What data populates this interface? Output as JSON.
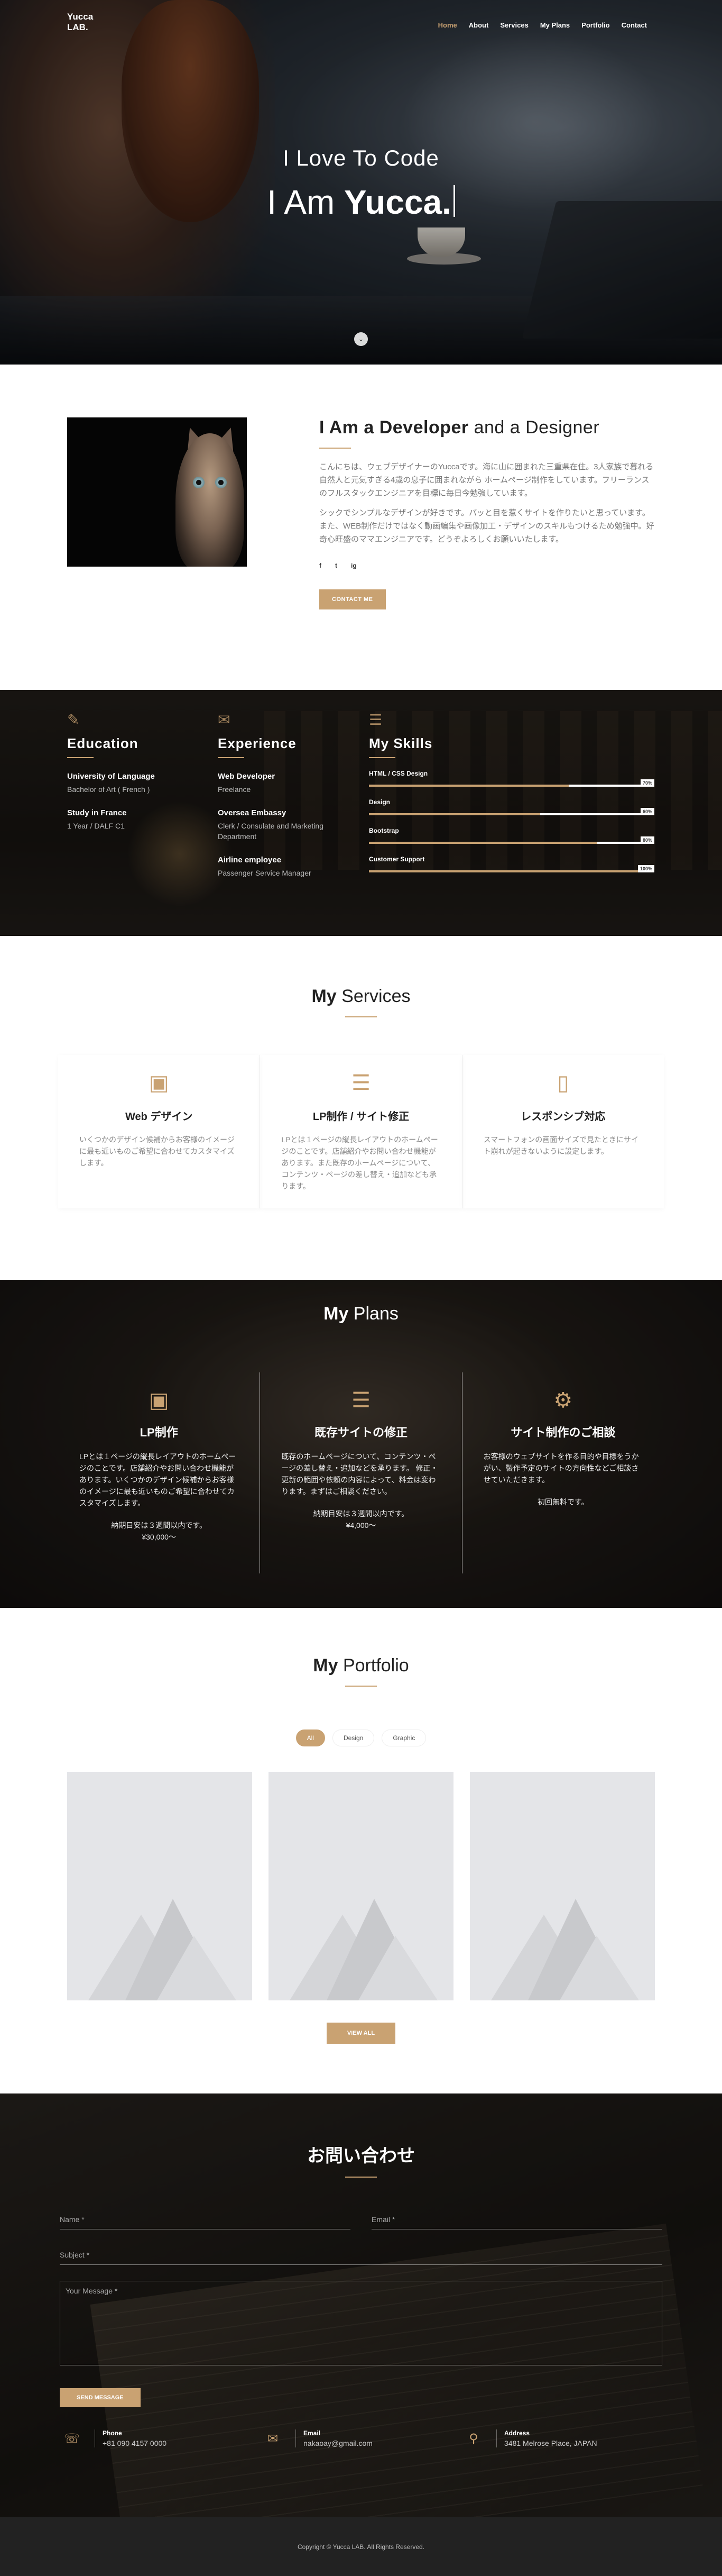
{
  "nav": {
    "logo_line1": "Yucca",
    "logo_line2": "LAB.",
    "items": [
      "Home",
      "About",
      "Services",
      "My Plans",
      "Portfolio",
      "Contact"
    ]
  },
  "hero": {
    "subtitle": "I Love To Code",
    "title_prefix": "I Am ",
    "title_bold": "Yucca.",
    "scroll_icon": "chevron-down-icon"
  },
  "about": {
    "title_bold": "I Am a Developer",
    "title_rest": " and a Designer",
    "p1": "こんにちは、ウェブデザイナーのYuccaです。海に山に囲まれた三重県在住。3人家族で暮れる自然人と元気すぎる4歳の息子に囲まれながら ホームページ制作をしています。フリーランスのフルスタックエンジニアを目標に毎日今勉強しています。",
    "p2": "シックでシンプルなデザインが好きです。パッと目を惹くサイトを作りたいと思っています。また、WEB制作だけではなく動画編集や画像加工・デザインのスキルもつけるため勉強中。好奇心旺盛のママエンジニアです。どうぞよろしくお願いいたします。",
    "socials": [
      "f",
      "t",
      "ig"
    ],
    "button": "CONTACT ME"
  },
  "resume": {
    "education": {
      "title": "Education",
      "items": [
        {
          "h": "University of Language",
          "d": "Bachelor of Art ( French )"
        },
        {
          "h": "Study in France",
          "d": "1 Year / DALF C1"
        }
      ]
    },
    "experience": {
      "title": "Experience",
      "items": [
        {
          "h": "Web Developer",
          "d": "Freelance"
        },
        {
          "h": "Oversea Embassy",
          "d": "Clerk / Consulate and Marketing Department"
        },
        {
          "h": "Airline employee",
          "d": "Passenger Service Manager"
        }
      ]
    },
    "skills": {
      "title": "My Skills",
      "items": [
        {
          "label": "HTML / CSS Design",
          "pct_text": "70%",
          "value": 0.7
        },
        {
          "label": "Design",
          "pct_text": "60%",
          "value": 0.6
        },
        {
          "label": "Bootstrap",
          "pct_text": "80%",
          "value": 0.8
        },
        {
          "label": "Customer Support",
          "pct_text": "100%",
          "value": 1.0
        }
      ]
    }
  },
  "services": {
    "title_bold": "My",
    "title_rest": " Services",
    "items": [
      {
        "icon": "laptop-icon",
        "title": "Web デザイン",
        "desc": "いくつかのデザイン候補からお客様のイメージに最も近いものご希望に合わせてカスタマイズします。"
      },
      {
        "icon": "layers-icon",
        "title": "LP制作 / サイト修正",
        "desc": "LPとは１ページの縦長レイアウトのホームページのことです。店舗紹介やお問い合わせ機能があります。また既存のホームページについて、コンテンツ・ページの差し替え・追加なども承ります。"
      },
      {
        "icon": "mobile-icon",
        "title": "レスポンシブ対応",
        "desc": "スマートフォンの画面サイズで見たときにサイト崩れが起きないように設定します。"
      }
    ]
  },
  "plans": {
    "title_bold": "My",
    "title_rest": " Plans",
    "items": [
      {
        "icon": "laptop-icon",
        "title": "LP制作",
        "desc": "LPとは１ページの縦長レイアウトのホームページのことです。店舗紹介やお問い合わせ機能があります。いくつかのデザイン候補からお客様のイメージに最も近いものご希望に合わせてカスタマイズします。",
        "price1": "納期目安は３週間以内です。",
        "price2": "¥30,000〜"
      },
      {
        "icon": "layers-icon",
        "title": "既存サイトの修正",
        "desc": "既存のホームページについて、コンテンツ・ページの差し替え・追加などを承ります。 修正・更新の範囲や依頼の内容によって、料金は変わります。まずはご相談ください。",
        "price1": "納期目安は３週間以内です。",
        "price2": "¥4,000〜"
      },
      {
        "icon": "gears-icon",
        "title": "サイト制作のご相談",
        "desc": "お客様のウェブサイトを作る目的や目標をうかがい、製作予定のサイトの方向性などご相談させていただきます。",
        "price1": "初回無料です。",
        "price2": ""
      }
    ]
  },
  "portfolio": {
    "title_bold": "My",
    "title_rest": " Portfolio",
    "filters": [
      "All",
      "Design",
      "Graphic"
    ],
    "button": "VIEW ALL"
  },
  "contact": {
    "title": "お問い合わせ",
    "name_placeholder": "Name *",
    "email_placeholder": "Email *",
    "subject_placeholder": "Subject *",
    "message_placeholder": "Your Message *",
    "send": "SEND MESSAGE",
    "info": [
      {
        "icon": "phone-icon",
        "k": "Phone",
        "v": "+81 090 4157 0000"
      },
      {
        "icon": "mail-icon",
        "k": "Email",
        "v": "nakaoay@gmail.com"
      },
      {
        "icon": "map-pin-icon",
        "k": "Address",
        "v": "3481 Melrose Place, JAPAN"
      }
    ]
  },
  "footer": {
    "text": "Copyright © Yucca LAB. All Rights Reserved."
  },
  "colors": {
    "accent": "#c9a272",
    "dark": "#222222"
  }
}
